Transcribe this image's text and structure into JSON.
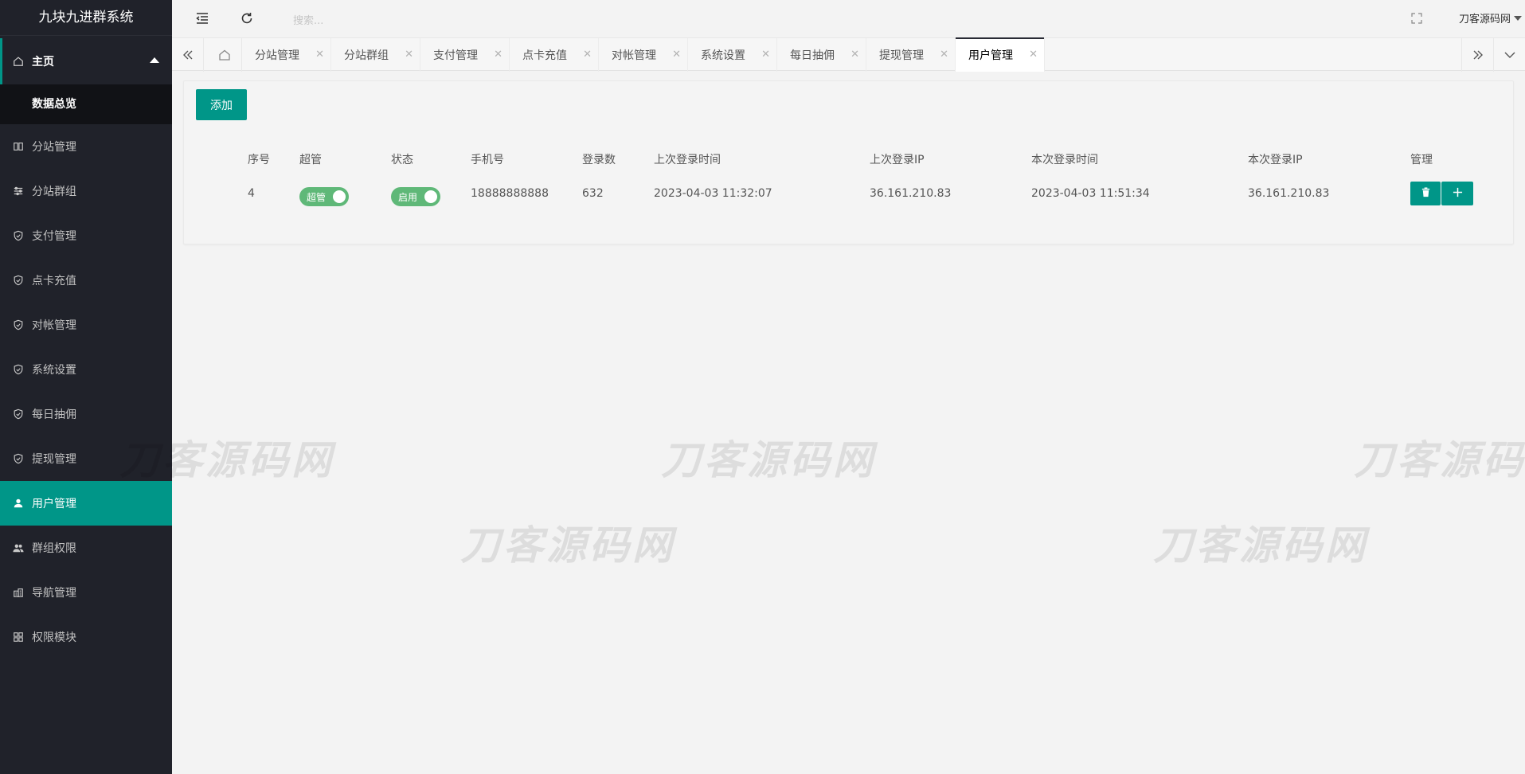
{
  "app": {
    "title": "九块九进群系统"
  },
  "sidebar": {
    "parent": {
      "label": "主页"
    },
    "sub": {
      "label": "数据总览"
    },
    "items": [
      {
        "label": "分站管理",
        "icon": "columns-icon"
      },
      {
        "label": "分站群组",
        "icon": "sliders-icon"
      },
      {
        "label": "支付管理",
        "icon": "shield-icon"
      },
      {
        "label": "点卡充值",
        "icon": "shield-icon"
      },
      {
        "label": "对帐管理",
        "icon": "shield-icon"
      },
      {
        "label": "系统设置",
        "icon": "shield-icon"
      },
      {
        "label": "每日抽佣",
        "icon": "shield-icon"
      },
      {
        "label": "提现管理",
        "icon": "shield-icon"
      },
      {
        "label": "用户管理",
        "icon": "user-icon",
        "active": true
      },
      {
        "label": "群组权限",
        "icon": "users-icon"
      },
      {
        "label": "导航管理",
        "icon": "buildings-icon"
      },
      {
        "label": "权限模块",
        "icon": "modules-icon"
      }
    ]
  },
  "header": {
    "search_placeholder": "搜索...",
    "user_name": "刀客源码网"
  },
  "tabs": [
    {
      "label": "分站管理"
    },
    {
      "label": "分站群组"
    },
    {
      "label": "支付管理"
    },
    {
      "label": "点卡充值"
    },
    {
      "label": "对帐管理"
    },
    {
      "label": "系统设置"
    },
    {
      "label": "每日抽佣"
    },
    {
      "label": "提现管理"
    },
    {
      "label": "用户管理",
      "active": true
    }
  ],
  "toolbar": {
    "add_label": "添加"
  },
  "table": {
    "headers": [
      "序号",
      "超管",
      "状态",
      "手机号",
      "登录数",
      "上次登录时间",
      "上次登录IP",
      "本次登录时间",
      "本次登录IP",
      "管理"
    ],
    "rows": [
      {
        "id": "4",
        "super_admin": "超管",
        "status": "启用",
        "phone": "18888888888",
        "login_count": "632",
        "last_login_time": "2023-04-03 11:32:07",
        "last_login_ip": "36.161.210.83",
        "this_login_time": "2023-04-03 11:51:34",
        "this_login_ip": "36.161.210.83"
      }
    ]
  },
  "watermark": {
    "text": "刀客源码网"
  },
  "colors": {
    "accent": "#009688",
    "sidebar_bg": "#20222a",
    "switch_on": "#5fb878"
  }
}
